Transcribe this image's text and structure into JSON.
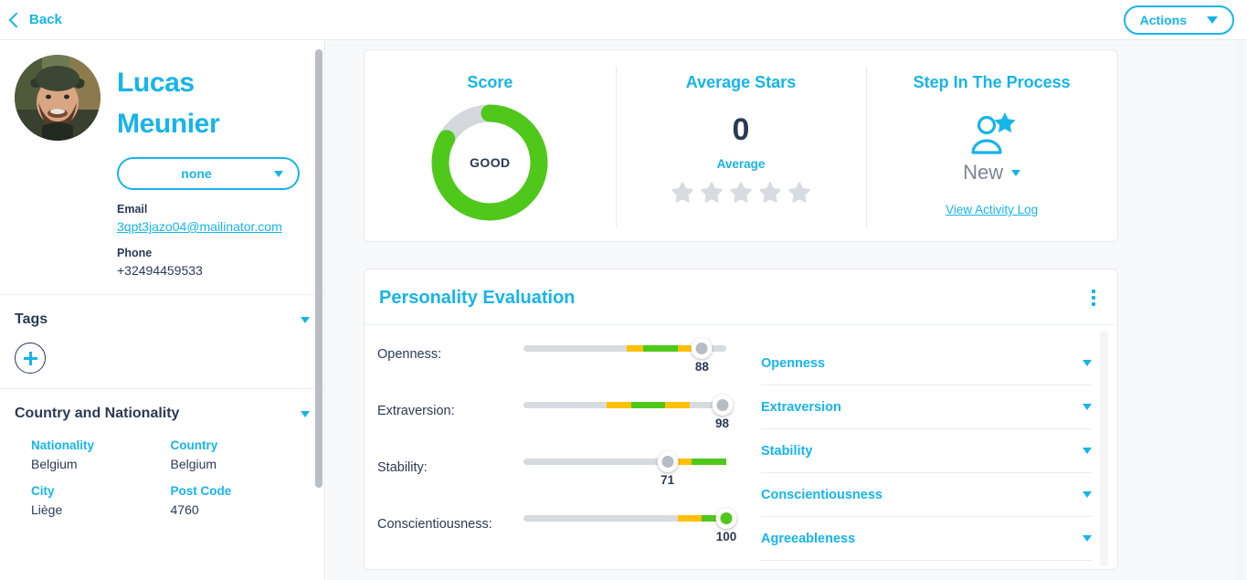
{
  "topbar": {
    "back_label": "Back",
    "actions_label": "Actions"
  },
  "sidebar": {
    "profile": {
      "first_name": "Lucas",
      "last_name": "Meunier",
      "status_select_value": "none",
      "email_label": "Email",
      "email_value": "3qpt3jazo04@mailinator.com",
      "phone_label": "Phone",
      "phone_value": "+32494459533"
    },
    "tags": {
      "title": "Tags"
    },
    "country": {
      "title": "Country and Nationality",
      "fields": [
        {
          "key": "Nationality",
          "value": "Belgium"
        },
        {
          "key": "Country",
          "value": "Belgium"
        },
        {
          "key": "City",
          "value": "Liège"
        },
        {
          "key": "Post Code",
          "value": "4760"
        }
      ]
    }
  },
  "stats": {
    "score": {
      "title": "Score",
      "center_label": "GOOD",
      "percent": 83,
      "fill_color": "#4fc81b",
      "track_color": "#d4d8dd"
    },
    "average_stars": {
      "title": "Average Stars",
      "value": "0",
      "caption": "Average",
      "star_count": 5,
      "filled_stars": 0,
      "star_color": "#d8dce0"
    },
    "step": {
      "title": "Step In The Process",
      "status": "New",
      "link_label": "View Activity Log"
    }
  },
  "personality": {
    "title": "Personality Evaluation",
    "traits": [
      {
        "label": "Openness:",
        "value": 88,
        "zones": [
          {
            "start": 51,
            "end": 59,
            "color": "#ffc107"
          },
          {
            "start": 59,
            "end": 76,
            "color": "#4fc81b"
          },
          {
            "start": 76,
            "end": 83,
            "color": "#ffc107"
          }
        ]
      },
      {
        "label": "Extraversion:",
        "value": 98,
        "zones": [
          {
            "start": 41,
            "end": 53,
            "color": "#ffc107"
          },
          {
            "start": 53,
            "end": 70,
            "color": "#4fc81b"
          },
          {
            "start": 70,
            "end": 82,
            "color": "#ffc107"
          }
        ]
      },
      {
        "label": "Stability:",
        "value": 71,
        "zones": [
          {
            "start": 73,
            "end": 83,
            "color": "#ffc107"
          },
          {
            "start": 83,
            "end": 100,
            "color": "#4fc81b"
          }
        ]
      },
      {
        "label": "Conscientiousness:",
        "value": 100,
        "zones": [
          {
            "start": 76,
            "end": 88,
            "color": "#ffc107"
          },
          {
            "start": 88,
            "end": 100,
            "color": "#4fc81b"
          }
        ]
      }
    ],
    "accordion": [
      {
        "label": "Openness"
      },
      {
        "label": "Extraversion"
      },
      {
        "label": "Stability"
      },
      {
        "label": "Conscientiousness"
      },
      {
        "label": "Agreeableness"
      }
    ]
  },
  "colors": {
    "accent": "#17b4e9",
    "dark": "#2b3a54",
    "green": "#4fc81b",
    "yellow": "#ffc107"
  }
}
